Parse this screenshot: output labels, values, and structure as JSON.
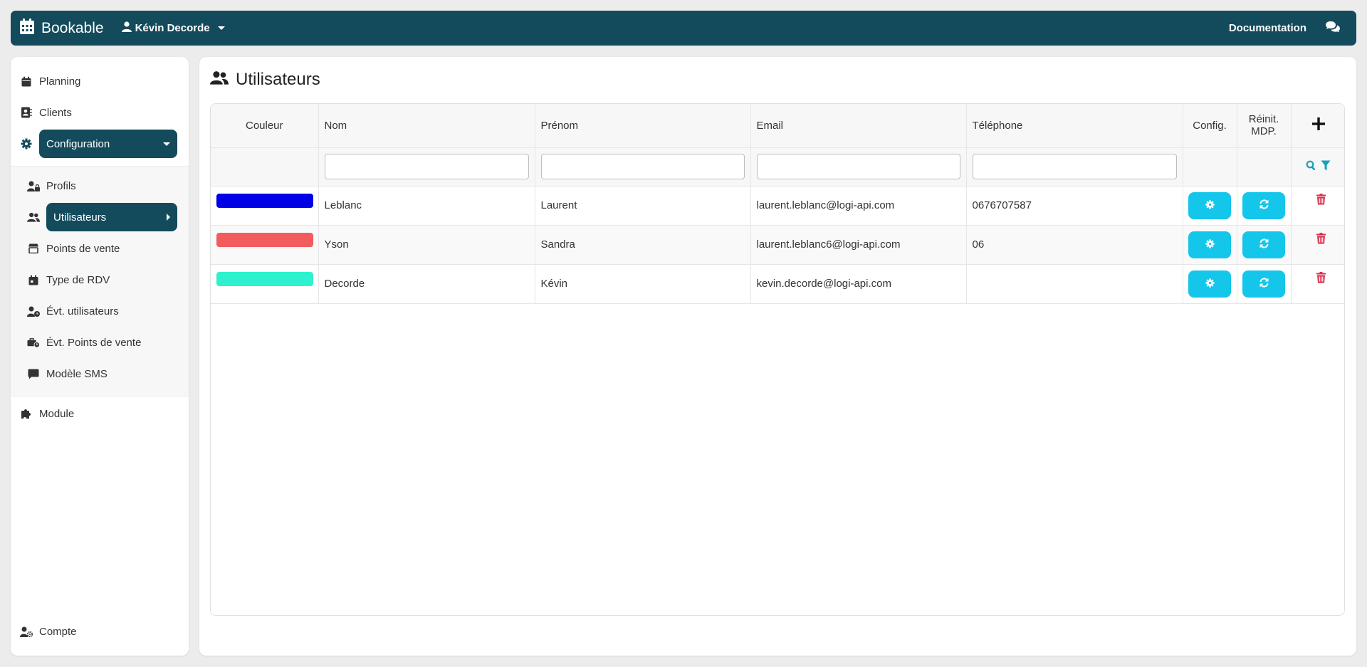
{
  "topbar": {
    "brand": "Bookable",
    "user": "Kévin Decorde",
    "documentation": "Documentation"
  },
  "sidebar": {
    "planning": "Planning",
    "clients": "Clients",
    "configuration": "Configuration",
    "sub": {
      "profils": "Profils",
      "utilisateurs": "Utilisateurs",
      "points_de_vente": "Points de vente",
      "type_rdv": "Type de RDV",
      "evt_utilisateurs": "Évt. utilisateurs",
      "evt_points_de_vente": "Évt. Points de vente",
      "modele_sms": "Modèle SMS"
    },
    "module": "Module",
    "compte": "Compte"
  },
  "page": {
    "title": "Utilisateurs"
  },
  "table": {
    "headers": {
      "couleur": "Couleur",
      "nom": "Nom",
      "prenom": "Prénom",
      "email": "Email",
      "telephone": "Téléphone",
      "config": "Config.",
      "reinit_line1": "Réinit.",
      "reinit_line2": "MDP."
    },
    "rows": [
      {
        "color": "#0000e6",
        "nom": "Leblanc",
        "prenom": "Laurent",
        "email": "laurent.leblanc@logi-api.com",
        "telephone": "0676707587"
      },
      {
        "color": "#f25c5c",
        "nom": "Yson",
        "prenom": "Sandra",
        "email": "laurent.leblanc6@logi-api.com",
        "telephone": "06"
      },
      {
        "color": "#2ef2cf",
        "nom": "Decorde",
        "prenom": "Kévin",
        "email": "kevin.decorde@logi-api.com",
        "telephone": ""
      }
    ]
  },
  "colors": {
    "primary": "#134b5c",
    "cyan": "#13c6ea",
    "danger": "#d9304f",
    "filter": "#1aa0b8"
  }
}
